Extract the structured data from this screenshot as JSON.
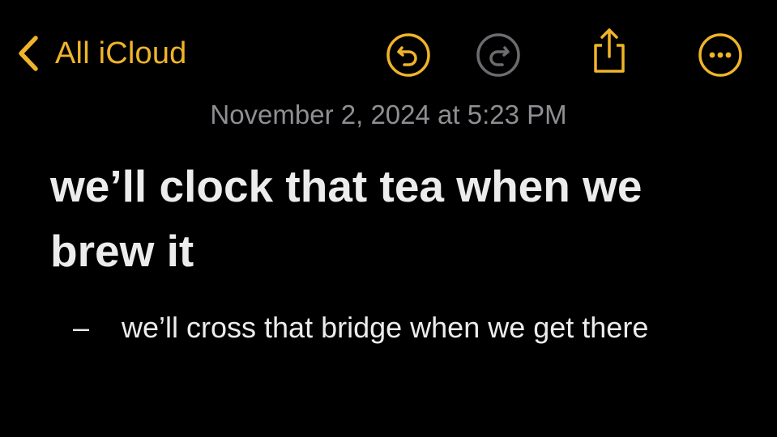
{
  "toolbar": {
    "back_label": "All iCloud",
    "back_icon": "chevron-left-icon",
    "undo_icon": "undo-icon",
    "redo_icon": "redo-icon",
    "share_icon": "share-icon",
    "more_icon": "more-icon",
    "accent_color": "#f0b429",
    "disabled_color": "#6c6c70"
  },
  "note": {
    "timestamp": "November 2, 2024 at 5:23 PM",
    "title": "we’ll clock that tea when we brew it",
    "bullets": [
      {
        "marker": "–",
        "text": "we’ll cross that bridge when we get there"
      }
    ]
  }
}
